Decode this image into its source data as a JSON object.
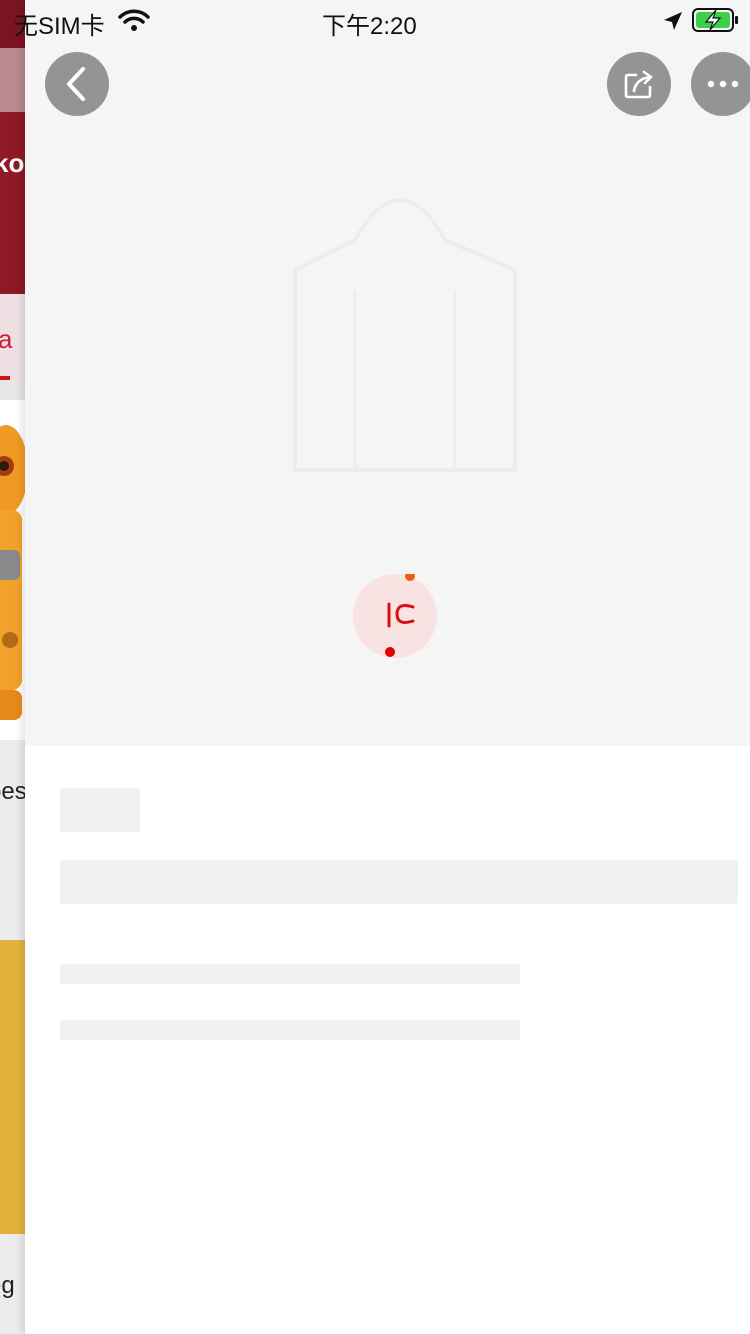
{
  "status_bar": {
    "carrier": "无SIM卡",
    "time": "下午2:20"
  },
  "background_page": {
    "fragments": [
      "ko",
      "a",
      "pes",
      "eg"
    ]
  },
  "nav": {
    "back_icon": "chevron-left-icon",
    "share_icon": "share-icon",
    "more_icon": "more-icon"
  },
  "loader": {
    "icon": "brand-logo-icon",
    "accent": "#e00000"
  },
  "colors": {
    "hero_bg": "#f5f5f5",
    "skeleton": "#f1f1f1",
    "nav_button": "#7a7a7a"
  }
}
